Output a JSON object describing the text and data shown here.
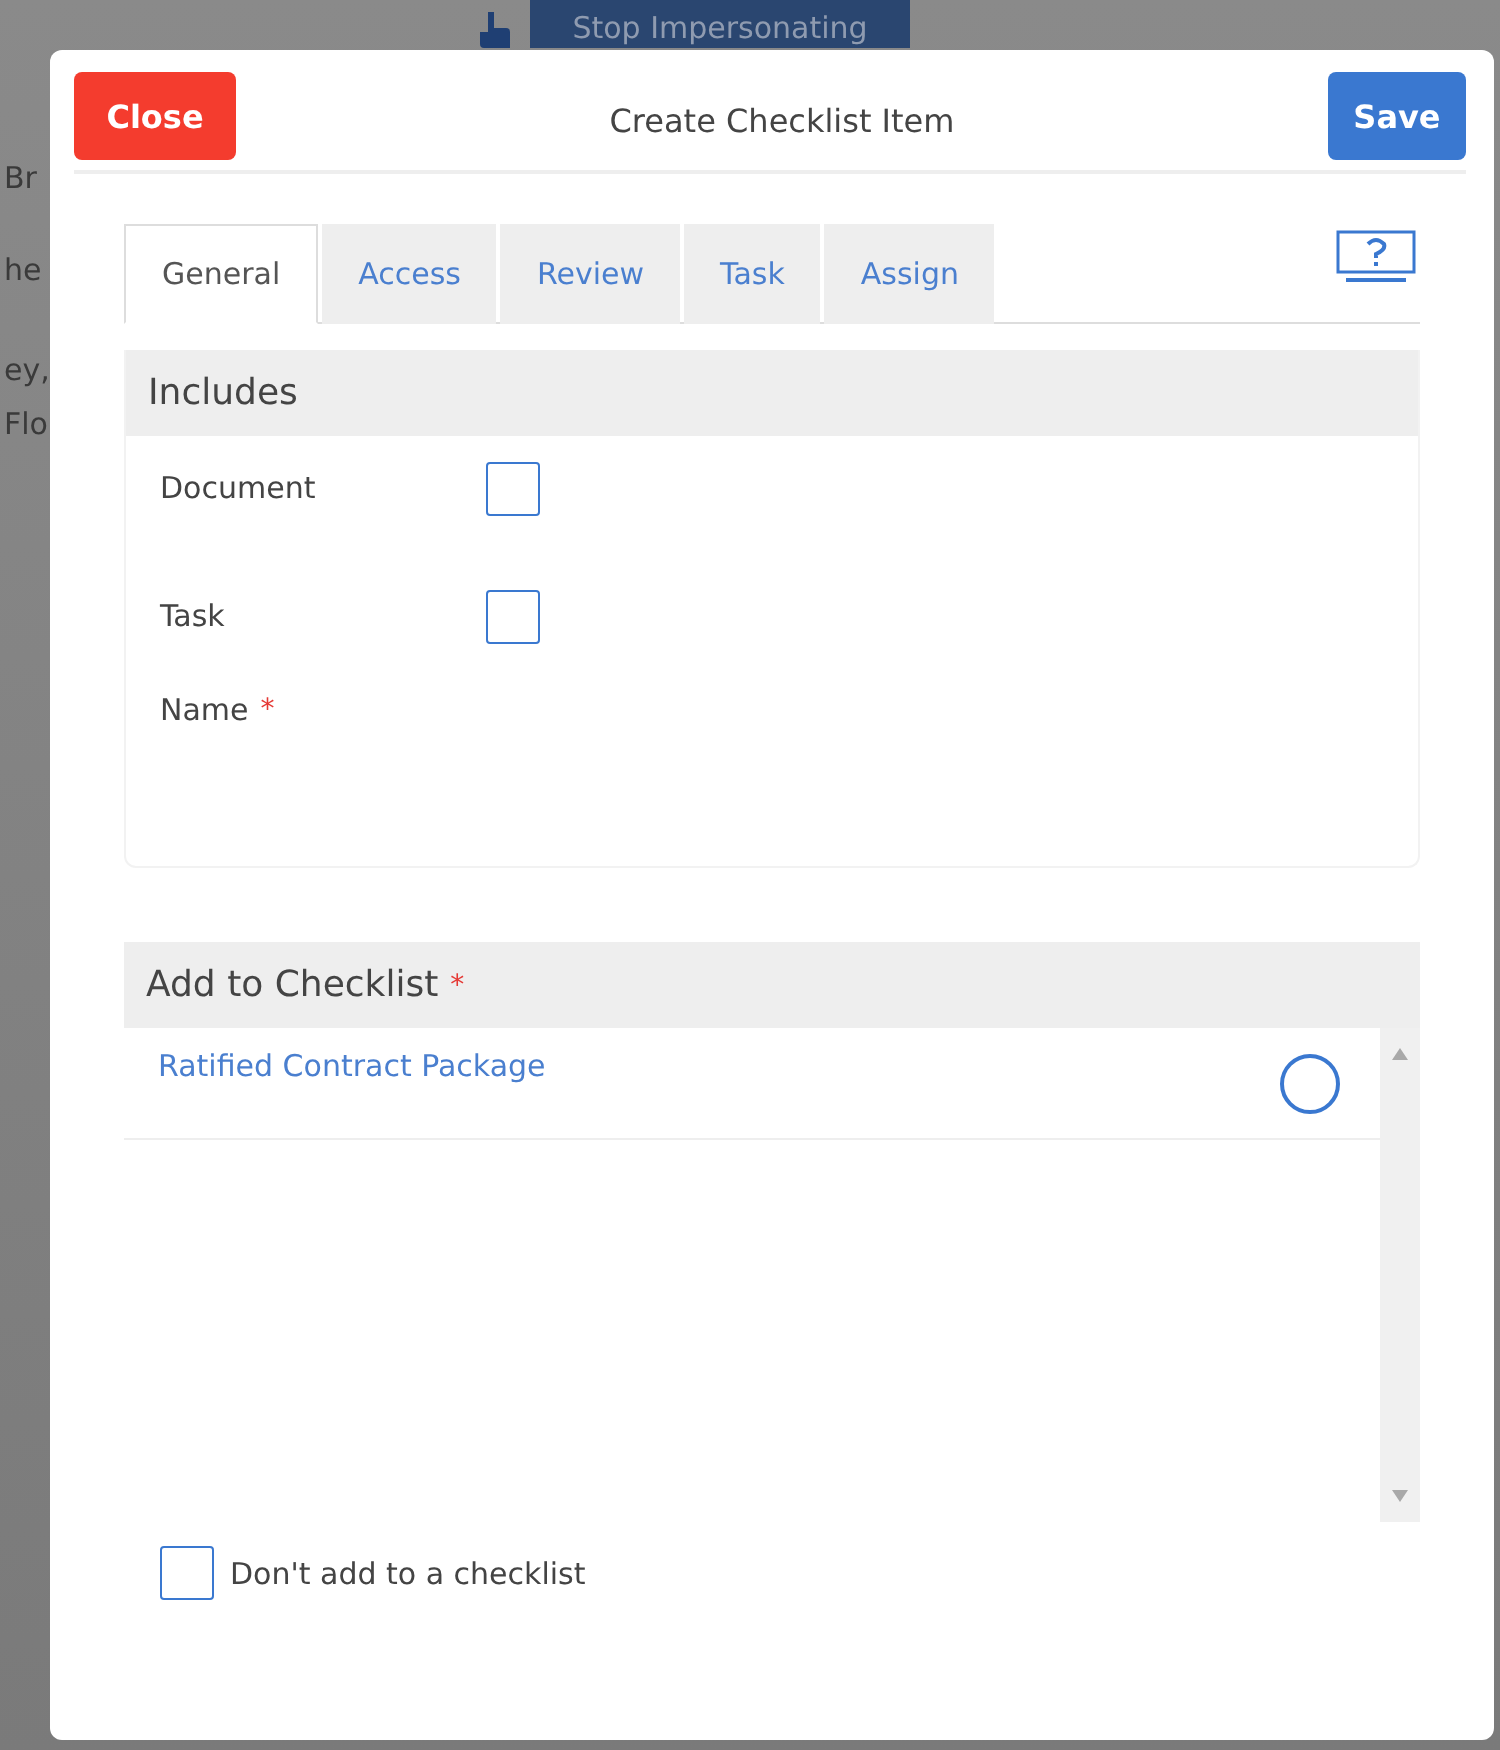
{
  "background": {
    "banner_button": "Stop Impersonating",
    "fragments": [
      "Br",
      "he",
      "ey,",
      "Flo"
    ]
  },
  "dialog": {
    "title": "Create Checklist Item",
    "close_button": "Close",
    "save_button": "Save"
  },
  "tabs": [
    {
      "label": "General",
      "selected": true
    },
    {
      "label": "Access",
      "selected": false
    },
    {
      "label": "Review",
      "selected": false
    },
    {
      "label": "Task",
      "selected": false
    },
    {
      "label": "Assign",
      "selected": false
    }
  ],
  "includes": {
    "heading": "Includes",
    "options": [
      {
        "label": "Document",
        "checked": false
      },
      {
        "label": "Task",
        "checked": false
      }
    ],
    "name_label": "Name",
    "name_required_mark": "*"
  },
  "checklist": {
    "heading": "Add to Checklist",
    "required_mark": "*",
    "items": [
      {
        "label": "Ratified Contract Package",
        "selected": false
      }
    ],
    "skip": {
      "label": "Don't add to a checklist",
      "checked": false
    }
  }
}
